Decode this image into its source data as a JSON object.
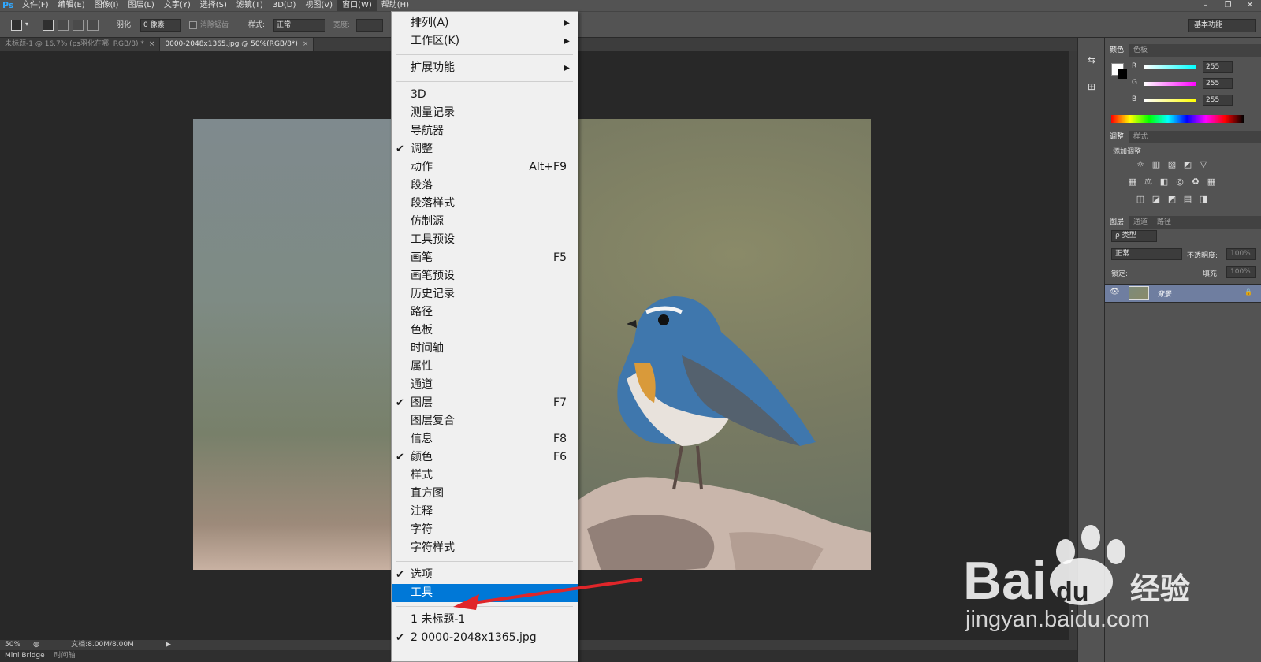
{
  "menubar": {
    "logo": "Ps",
    "items": [
      "文件(F)",
      "编辑(E)",
      "图像(I)",
      "图层(L)",
      "文字(Y)",
      "选择(S)",
      "滤镜(T)",
      "3D(D)",
      "视图(V)",
      "窗口(W)",
      "帮助(H)"
    ],
    "active_index": 9
  },
  "window_controls": {
    "minimize": "–",
    "restore": "❐",
    "close": "✕"
  },
  "options": {
    "feather_label": "羽化:",
    "feather_value": "0 像素",
    "antialias_label": "消除锯齿",
    "style_label": "样式:",
    "style_value": "正常",
    "width_label": "宽度:",
    "workspace": "基本功能"
  },
  "tabs": [
    {
      "label": "未标题-1 @ 16.7% (ps羽化在哪, RGB/8) *",
      "active": false,
      "close": "×"
    },
    {
      "label": "0000-2048x1365.jpg @ 50%(RGB/8*)",
      "active": true,
      "close": "×"
    }
  ],
  "status": {
    "zoom": "50%",
    "doc_info": "文档:8.00M/8.00M",
    "play": "▶",
    "bottom_tabs": [
      "Mini Bridge",
      "时间轴"
    ]
  },
  "panels": {
    "color_tabs": [
      "颜色",
      "色板"
    ],
    "rgb": [
      {
        "label": "R",
        "value": "255",
        "gradient": "#00ffff"
      },
      {
        "label": "G",
        "value": "255",
        "gradient": "#ff00ff"
      },
      {
        "label": "B",
        "value": "255",
        "gradient": "#ffff00"
      }
    ],
    "adjust_tabs": [
      "调整",
      "样式"
    ],
    "add_adjustment": "添加调整",
    "adjust_icons": [
      "☼",
      "▥",
      "▨",
      "◩",
      "▽",
      "▦",
      "⚖",
      "◧",
      "◎",
      "♻",
      "▦",
      "◫",
      "◪",
      "◩",
      "▤",
      "◨"
    ],
    "layers_tabs": [
      "图层",
      "通道",
      "路径"
    ],
    "filter_kind": "ρ 类型",
    "blend_mode": "正常",
    "opacity_label": "不透明度:",
    "opacity_value": "100%",
    "lock_label": "锁定:",
    "fill_label": "填充:",
    "fill_value": "100%",
    "layer_name": "背景",
    "eye": "👁",
    "lock": "🔒"
  },
  "window_menu": {
    "groups": [
      [
        {
          "label": "排列(A)",
          "submenu": true
        },
        {
          "label": "工作区(K)",
          "submenu": true
        }
      ],
      [
        {
          "label": "扩展功能",
          "submenu": true
        }
      ],
      [
        {
          "label": "3D"
        },
        {
          "label": "测量记录"
        },
        {
          "label": "导航器"
        },
        {
          "label": "调整",
          "checked": true
        },
        {
          "label": "动作",
          "shortcut": "Alt+F9"
        },
        {
          "label": "段落"
        },
        {
          "label": "段落样式"
        },
        {
          "label": "仿制源"
        },
        {
          "label": "工具预设"
        },
        {
          "label": "画笔",
          "shortcut": "F5"
        },
        {
          "label": "画笔预设"
        },
        {
          "label": "历史记录"
        },
        {
          "label": "路径"
        },
        {
          "label": "色板"
        },
        {
          "label": "时间轴"
        },
        {
          "label": "属性"
        },
        {
          "label": "通道"
        },
        {
          "label": "图层",
          "checked": true,
          "shortcut": "F7"
        },
        {
          "label": "图层复合"
        },
        {
          "label": "信息",
          "shortcut": "F8"
        },
        {
          "label": "颜色",
          "checked": true,
          "shortcut": "F6"
        },
        {
          "label": "样式"
        },
        {
          "label": "直方图"
        },
        {
          "label": "注释"
        },
        {
          "label": "字符"
        },
        {
          "label": "字符样式"
        }
      ],
      [
        {
          "label": "选项",
          "checked": true
        },
        {
          "label": "工具",
          "highlighted": true
        }
      ],
      [
        {
          "label": "1 未标题-1"
        },
        {
          "label": "2 0000-2048x1365.jpg",
          "checked": true
        }
      ]
    ],
    "check_glyph": "✔",
    "submenu_glyph": "▶"
  },
  "watermark": {
    "logo_text": "Bai",
    "logo_text2": "du",
    "logo_cn": "经验",
    "url": "jingyan.baidu.com"
  },
  "colors": {
    "highlight": "#0078d7",
    "arrow": "#e0262a",
    "ui_bg": "#535353",
    "canvas_bg": "#282828"
  }
}
